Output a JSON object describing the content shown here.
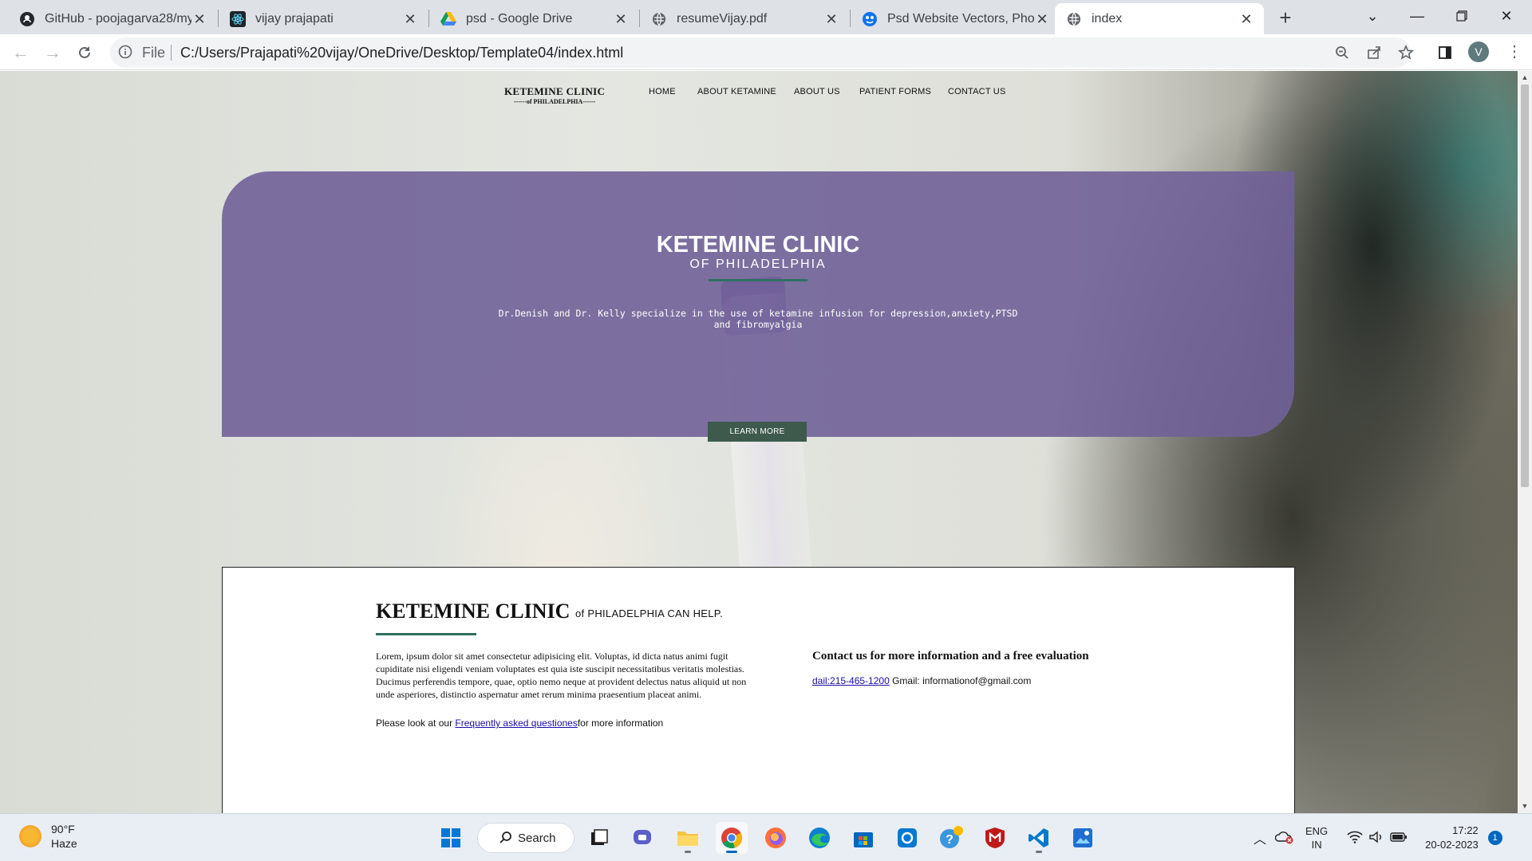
{
  "browser": {
    "tabs": [
      {
        "title": "GitHub - poojagarva28/my",
        "icon": "github-icon"
      },
      {
        "title": "vijay prajapati",
        "icon": "react-icon"
      },
      {
        "title": "psd - Google Drive",
        "icon": "google-drive-icon"
      },
      {
        "title": "resumeVijay.pdf",
        "icon": "globe-icon"
      },
      {
        "title": "Psd Website Vectors, Photo",
        "icon": "freepik-icon"
      },
      {
        "title": "index",
        "icon": "globe-icon"
      }
    ],
    "address": {
      "scheme_label": "File",
      "url": "C:/Users/Prajapati%20vijay/OneDrive/Desktop/Template04/index.html"
    },
    "profile_initial": "V"
  },
  "site": {
    "brand": {
      "line1": "KETEMINE CLINIC",
      "line2": "------of PHILADELPHIA------"
    },
    "nav": [
      "HOME",
      "ABOUT KETAMINE",
      "ABOUT US",
      "PATIENT FORMS",
      "CONTACT US"
    ],
    "hero": {
      "title": "KETEMINE CLINIC",
      "subtitle": "OF PHILADELPHIA",
      "text": "Dr.Denish and Dr. Kelly specialize in the use of ketamine infusion for depression,anxiety,PTSD and fibromyalgia",
      "button": "LEARN MORE"
    },
    "info": {
      "title_big": "KETEMINE CLINIC",
      "title_small": "of PHILADELPHIA CAN HELP.",
      "lorem": "Lorem, ipsum dolor sit amet consectetur adipisicing elit. Voluptas, id dicta natus animi fugit cupiditate nisi eligendi veniam voluptates est quia iste suscipit necessitatibus veritatis molestias. Ducimus perferendis tempore, quae, optio nemo neque at provident delectus natus aliquid ut non unde asperiores, distinctio aspernatur amet rerum minima praesentium placeat animi.",
      "faq_prefix": "Please look at our ",
      "faq_link": "Frequently asked questiones",
      "faq_suffix": "for more information",
      "contact_heading": "Contact us for more information and a free evaluation",
      "phone_link": "dail:215-465-1200",
      "email": " Gmail: informationof@gmail.com"
    }
  },
  "taskbar": {
    "weather": {
      "temp": "90°F",
      "condition": "Haze"
    },
    "search_label": "Search",
    "lang_line1": "ENG",
    "lang_line2": "IN",
    "time": "17:22",
    "date": "20-02-2023",
    "notification_count": "1"
  }
}
